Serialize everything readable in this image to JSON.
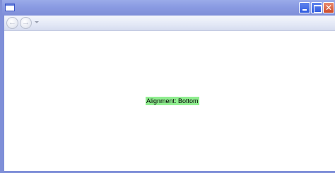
{
  "window": {
    "title": "",
    "controls": {
      "minimize": "",
      "maximize": "",
      "close": "✕"
    }
  },
  "navigation": {
    "back_glyph": "←",
    "forward_glyph": "→"
  },
  "content": {
    "label_text": "Alignment: Bottom",
    "label_background": "#90ee90"
  },
  "colors": {
    "titlebar": "#8a9be2",
    "close_button": "#cd4b2b"
  }
}
